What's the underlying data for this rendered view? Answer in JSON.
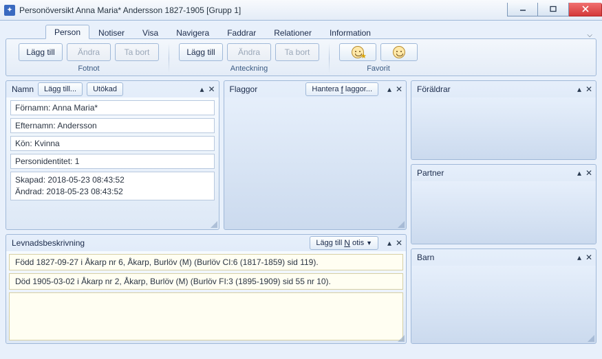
{
  "window": {
    "title": "Personöversikt Anna Maria* Andersson 1827-1905 [Grupp 1]"
  },
  "tabs": {
    "person": "Person",
    "notiser": "Notiser",
    "visa": "Visa",
    "navigera": "Navigera",
    "faddrar": "Faddrar",
    "relationer": "Relationer",
    "information": "Information"
  },
  "ribbon": {
    "fotnot": {
      "laggtill": "Lägg till",
      "andra": "Ändra",
      "tabort": "Ta bort",
      "label": "Fotnot"
    },
    "anteckning": {
      "laggtill": "Lägg till",
      "andra": "Ändra",
      "tabort": "Ta bort",
      "label": "Anteckning"
    },
    "favorit": {
      "label": "Favorit"
    }
  },
  "panels": {
    "namn": {
      "title": "Namn",
      "laggtill": "Lägg till...",
      "utokad": "Utökad",
      "fornamn": "Förnamn: Anna Maria*",
      "efternamn": "Efternamn: Andersson",
      "kon": "Kön: Kvinna",
      "personidentitet": "Personidentitet: 1",
      "skapad": "Skapad: 2018-05-23 08:43:52",
      "andrad": "Ändrad: 2018-05-23 08:43:52"
    },
    "flaggor": {
      "title": "Flaggor",
      "hantera": "Hantera flaggor..."
    },
    "levnads": {
      "title": "Levnadsbeskrivning",
      "laggtillnotis": "Lägg till Notis",
      "items": [
        "Född 1827-09-27 i Åkarp nr 6, Åkarp, Burlöv (M) (Burlöv CI:6 (1817-1859) sid 119).",
        "Död 1905-03-02 i Åkarp nr 2, Åkarp, Burlöv (M) (Burlöv FI:3 (1895-1909) sid 55 nr 10)."
      ]
    },
    "foraldrar": {
      "title": "Föräldrar"
    },
    "partner": {
      "title": "Partner"
    },
    "barn": {
      "title": "Barn"
    }
  }
}
